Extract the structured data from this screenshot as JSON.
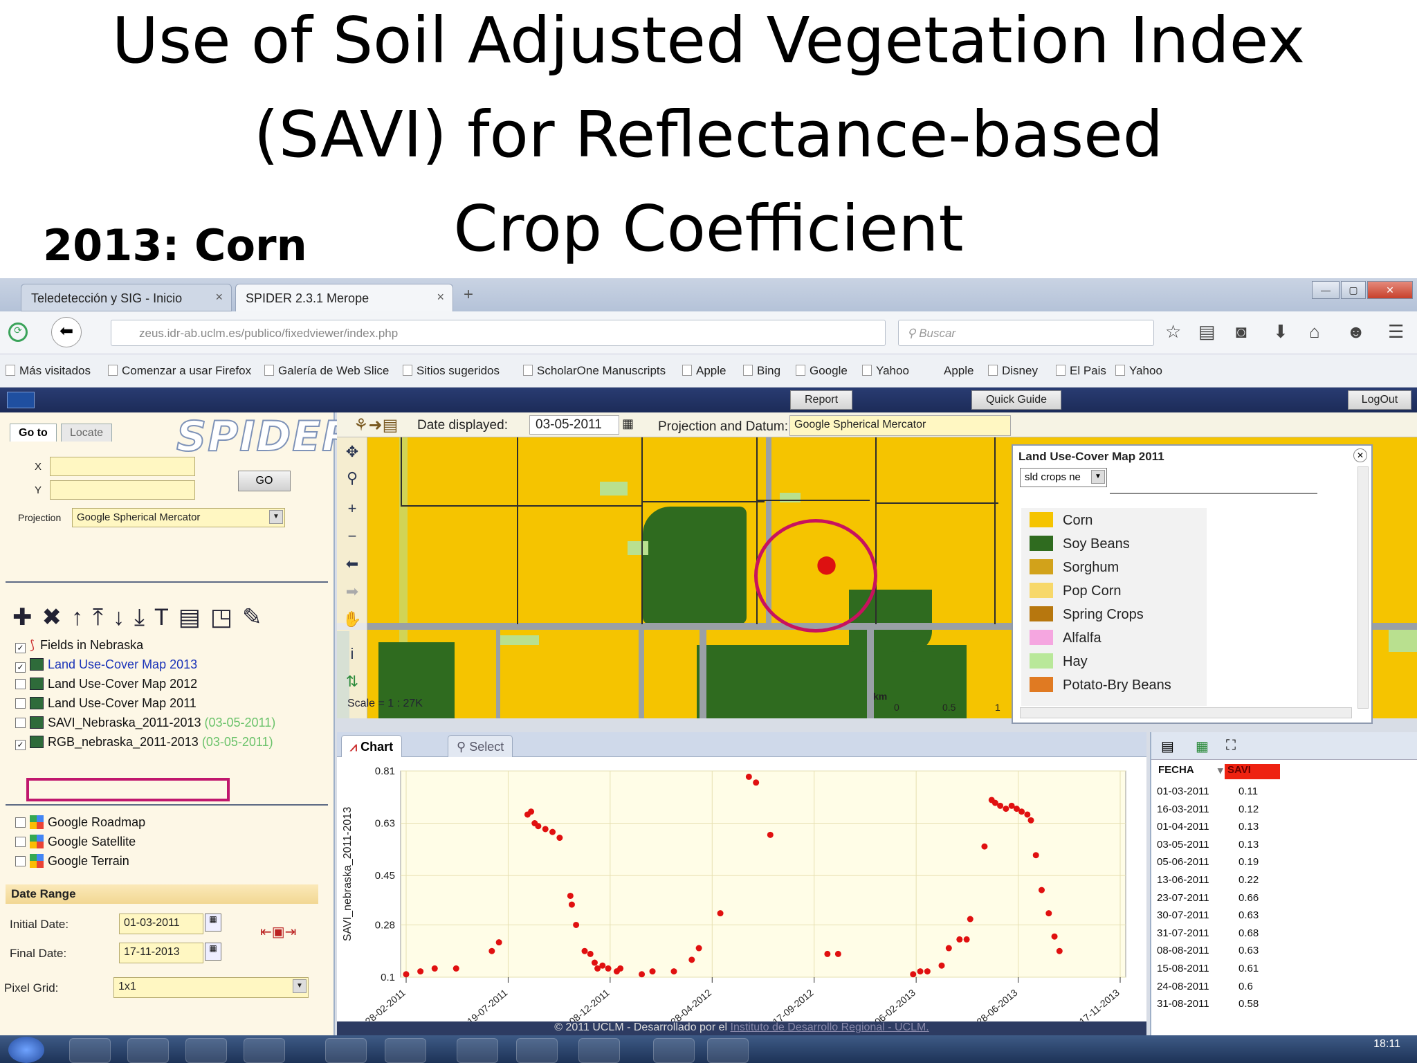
{
  "slide": {
    "title_lines": [
      "Use of Soil Adjusted Vegetation Index",
      "(SAVI) for Reflectance-based",
      "Crop Coefficient"
    ],
    "year_label": "2013: Corn"
  },
  "browser": {
    "tabs": [
      {
        "label": "Teledetección y SIG - Inicio",
        "close": "×"
      },
      {
        "label": "SPIDER 2.3.1 Merope",
        "close": "×"
      }
    ],
    "new_tab": "+",
    "url": "zeus.idr-ab.uclm.es/publico/fixedviewer/index.php",
    "search_placeholder": "Buscar",
    "bookmarks": [
      "Más visitados",
      "Comenzar a usar Firefox",
      "Galería de Web Slice",
      "Sitios sugeridos",
      "ScholarOne Manuscripts",
      "Apple",
      "Bing",
      "Google",
      "Yahoo",
      "Apple",
      "Disney",
      "El Pais",
      "Yahoo"
    ],
    "icons": [
      "back-icon",
      "reload-icon",
      "search-icon",
      "star-icon",
      "clipboard-icon",
      "pocket-icon",
      "download-icon",
      "home-icon",
      "chat-icon",
      "menu-icon"
    ]
  },
  "app": {
    "top_buttons": {
      "report": "Report",
      "quick_guide": "Quick Guide",
      "logout": "LogOut"
    },
    "logo": "SPIDER",
    "left": {
      "tabs": [
        "Go to",
        "Locate"
      ],
      "x_label": "X",
      "y_label": "Y",
      "go": "GO",
      "projection_label": "Projection",
      "projection_value": "Google Spherical Mercator",
      "layers": [
        {
          "name": "Fields in Nebraska",
          "checked": true,
          "date": ""
        },
        {
          "name": "Land Use-Cover Map 2013",
          "checked": true,
          "date": ""
        },
        {
          "name": "Land Use-Cover Map 2012",
          "checked": false,
          "date": ""
        },
        {
          "name": "Land Use-Cover Map 2011",
          "checked": false,
          "date": ""
        },
        {
          "name": "SAVI_Nebraska_2011-2013",
          "checked": false,
          "date": "(03-05-2011)"
        },
        {
          "name": "RGB_nebraska_2011-2013",
          "checked": true,
          "date": "(03-05-2011)"
        }
      ],
      "basemaps": [
        "Google Roadmap",
        "Google Satellite",
        "Google Terrain"
      ],
      "date_range": {
        "heading": "Date Range",
        "initial_label": "Initial Date:",
        "initial_value": "01-03-2011",
        "final_label": "Final Date:",
        "final_value": "17-11-2013",
        "pixel_label": "Pixel Grid:",
        "pixel_value": "1x1"
      }
    },
    "map": {
      "date_label": "Date displayed:",
      "date_value": "03-05-2011",
      "proj_label": "Projection and Datum:",
      "proj_value": "Google Spherical Mercator",
      "scale": "Scale = 1 : 27K",
      "km_label": "km",
      "km_ticks": [
        "0",
        "0.5",
        "1"
      ]
    },
    "legend": {
      "title": "Land Use-Cover Map 2011",
      "select": "sld crops ne",
      "items": [
        {
          "label": "Corn",
          "color": "#f5c400"
        },
        {
          "label": "Soy Beans",
          "color": "#2f6b1f"
        },
        {
          "label": "Sorghum",
          "color": "#d2a21a"
        },
        {
          "label": "Pop Corn",
          "color": "#f7d86a"
        },
        {
          "label": "Spring Crops",
          "color": "#b7770e"
        },
        {
          "label": "Alfalfa",
          "color": "#f5a6e0"
        },
        {
          "label": "Hay",
          "color": "#b9e89a"
        },
        {
          "label": "Potato-Bry Beans",
          "color": "#e07a22"
        }
      ]
    },
    "chart_tabs": [
      "Chart",
      "Select"
    ],
    "table": {
      "col_date": "FECHA",
      "col_val": "SAVI",
      "rows": [
        [
          "01-03-2011",
          "0.11"
        ],
        [
          "16-03-2011",
          "0.12"
        ],
        [
          "01-04-2011",
          "0.13"
        ],
        [
          "03-05-2011",
          "0.13"
        ],
        [
          "05-06-2011",
          "0.19"
        ],
        [
          "13-06-2011",
          "0.22"
        ],
        [
          "23-07-2011",
          "0.66"
        ],
        [
          "30-07-2011",
          "0.63"
        ],
        [
          "31-07-2011",
          "0.68"
        ],
        [
          "08-08-2011",
          "0.63"
        ],
        [
          "15-08-2011",
          "0.61"
        ],
        [
          "24-08-2011",
          "0.6"
        ],
        [
          "31-08-2011",
          "0.58"
        ]
      ]
    },
    "footer": {
      "text": "© 2011 UCLM - Desarrollado por el",
      "link": "Instituto de Desarrollo Regional - UCLM."
    }
  },
  "taskbar": {
    "clock": "18:11"
  },
  "chart_data": {
    "type": "scatter",
    "ylabel": "SAVI_nebraska_2011-2013",
    "ylim": [
      0.1,
      0.81
    ],
    "yticks": [
      "0.1",
      "0.28",
      "0.45",
      "0.63",
      "0.81"
    ],
    "xticks": [
      "28-02-2011",
      "19-07-2011",
      "08-12-2011",
      "28-04-2012",
      "17-09-2012",
      "06-02-2013",
      "28-06-2013",
      "17-11-2013"
    ],
    "color": "#e01010",
    "points": [
      [
        0.0,
        0.11
      ],
      [
        0.02,
        0.12
      ],
      [
        0.04,
        0.13
      ],
      [
        0.07,
        0.13
      ],
      [
        0.12,
        0.19
      ],
      [
        0.13,
        0.22
      ],
      [
        0.17,
        0.66
      ],
      [
        0.175,
        0.67
      ],
      [
        0.18,
        0.63
      ],
      [
        0.185,
        0.62
      ],
      [
        0.195,
        0.61
      ],
      [
        0.205,
        0.6
      ],
      [
        0.215,
        0.58
      ],
      [
        0.23,
        0.38
      ],
      [
        0.232,
        0.35
      ],
      [
        0.238,
        0.28
      ],
      [
        0.25,
        0.19
      ],
      [
        0.258,
        0.18
      ],
      [
        0.264,
        0.15
      ],
      [
        0.268,
        0.13
      ],
      [
        0.275,
        0.14
      ],
      [
        0.283,
        0.13
      ],
      [
        0.295,
        0.12
      ],
      [
        0.3,
        0.13
      ],
      [
        0.33,
        0.11
      ],
      [
        0.345,
        0.12
      ],
      [
        0.375,
        0.12
      ],
      [
        0.4,
        0.16
      ],
      [
        0.41,
        0.2
      ],
      [
        0.44,
        0.32
      ],
      [
        0.48,
        0.79
      ],
      [
        0.49,
        0.77
      ],
      [
        0.51,
        0.59
      ],
      [
        0.59,
        0.18
      ],
      [
        0.605,
        0.18
      ],
      [
        0.71,
        0.11
      ],
      [
        0.72,
        0.12
      ],
      [
        0.73,
        0.12
      ],
      [
        0.75,
        0.14
      ],
      [
        0.76,
        0.2
      ],
      [
        0.775,
        0.23
      ],
      [
        0.785,
        0.23
      ],
      [
        0.79,
        0.3
      ],
      [
        0.81,
        0.55
      ],
      [
        0.82,
        0.71
      ],
      [
        0.825,
        0.7
      ],
      [
        0.832,
        0.69
      ],
      [
        0.84,
        0.68
      ],
      [
        0.848,
        0.69
      ],
      [
        0.855,
        0.68
      ],
      [
        0.862,
        0.67
      ],
      [
        0.87,
        0.66
      ],
      [
        0.875,
        0.64
      ],
      [
        0.882,
        0.52
      ],
      [
        0.89,
        0.4
      ],
      [
        0.9,
        0.32
      ],
      [
        0.908,
        0.24
      ],
      [
        0.915,
        0.19
      ]
    ]
  }
}
